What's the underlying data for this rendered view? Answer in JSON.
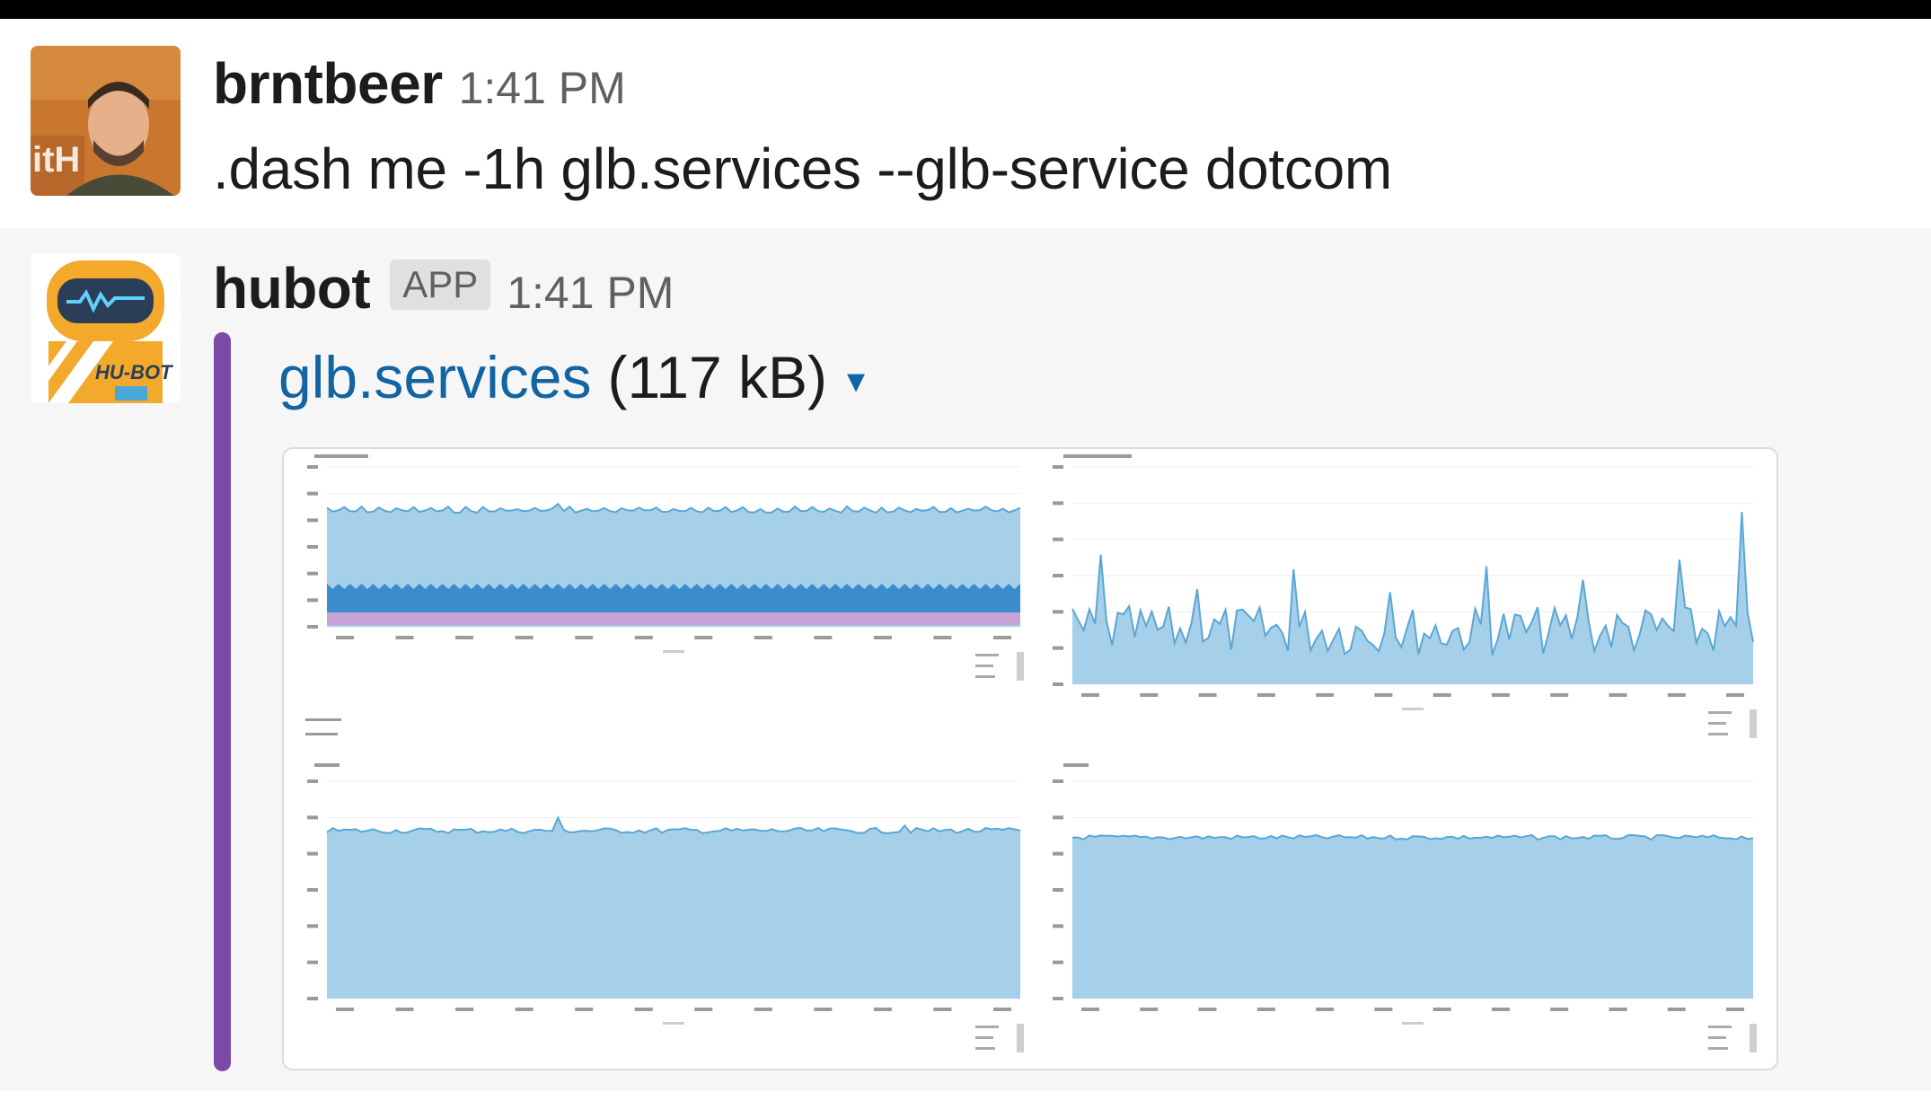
{
  "messages": [
    {
      "sender": "brntbeer",
      "time": "1:41 PM",
      "text": ".dash me -1h glb.services --glb-service dotcom",
      "avatar": "user-photo-avatar"
    },
    {
      "sender": "hubot",
      "badge": "APP",
      "time": "1:41 PM",
      "avatar": "hubot-robot-avatar",
      "attachment": {
        "name": "glb.services",
        "size": "(117 kB)",
        "caret": "▾",
        "accent_color": "#7a4aa6",
        "link_color": "#1264a3",
        "preview": "dashboard-graphs-preview"
      }
    }
  ],
  "colors": {
    "area_blue": "#a6d0ea",
    "line_blue": "#5aa6d6",
    "dark_blue": "#3a8ccc",
    "purple": "#c6a4d8"
  }
}
